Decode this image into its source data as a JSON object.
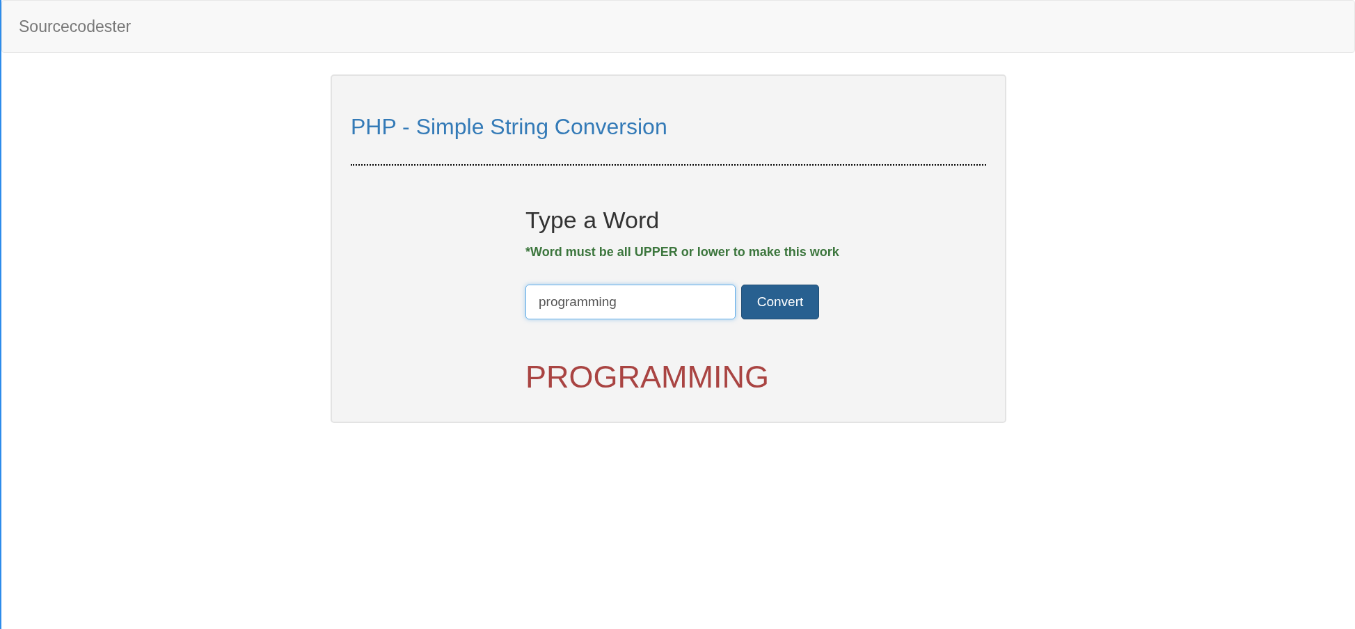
{
  "navbar": {
    "brand": "Sourcecodester"
  },
  "panel": {
    "title": "PHP - Simple String Conversion",
    "form": {
      "heading": "Type a Word",
      "hint": "*Word must be all UPPER or lower to make this work",
      "input": {
        "value": "programming"
      },
      "button": "Convert"
    },
    "result": "PROGRAMMING"
  }
}
